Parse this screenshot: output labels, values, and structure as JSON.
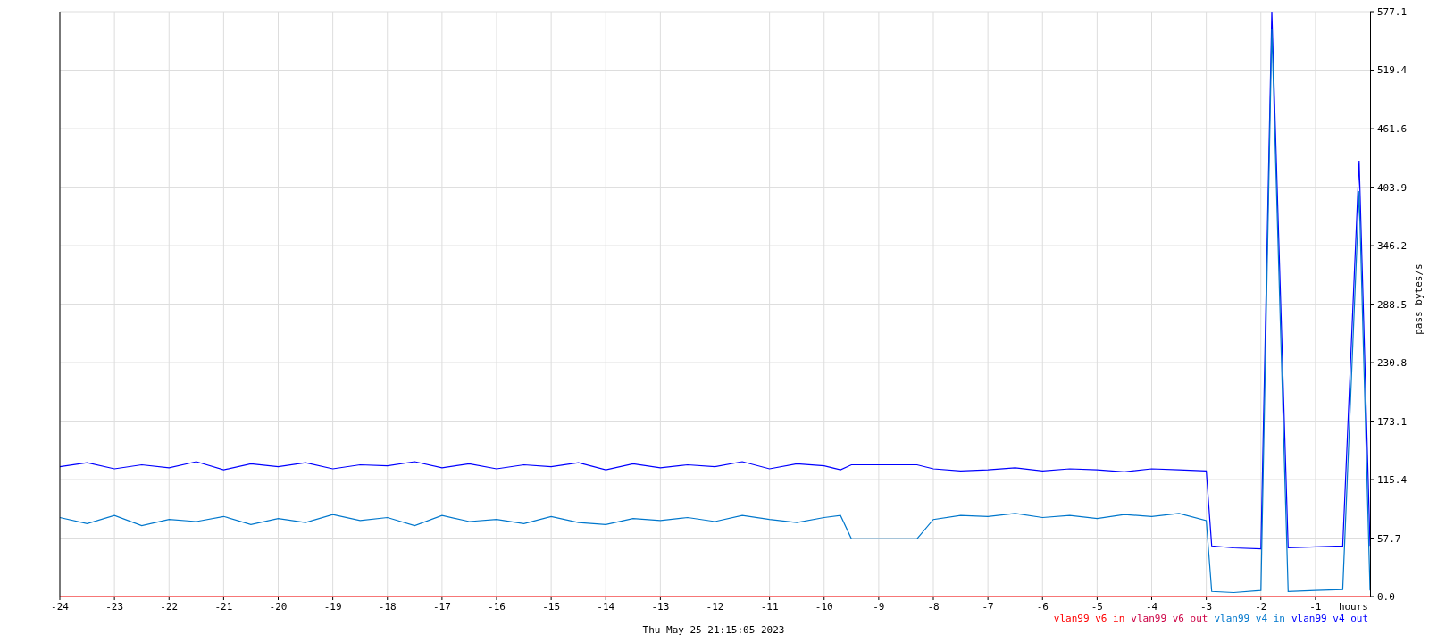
{
  "graph": {
    "timestamp": "Thu May 25 21:15:05 2023",
    "chart_data": {
      "type": "line",
      "grid": true,
      "xlabel": "hours",
      "ylabel": "pass bytes/s",
      "xlim": [
        -24,
        0
      ],
      "ylim": [
        0,
        577.1
      ],
      "xticks": [
        -24,
        -23,
        -22,
        -21,
        -20,
        -19,
        -18,
        -17,
        -16,
        -15,
        -14,
        -13,
        -12,
        -11,
        -10,
        -9,
        -8,
        -7,
        -6,
        -5,
        -4,
        -3,
        -2,
        -1
      ],
      "yticks": [
        {
          "value": 0,
          "label": "0.0"
        },
        57.7,
        115.4,
        173.1,
        230.8,
        288.5,
        346.2,
        403.9,
        461.6,
        519.4,
        577.1
      ],
      "x": [
        -24,
        -23.5,
        -23,
        -22.5,
        -22,
        -21.5,
        -21,
        -20.5,
        -20,
        -19.5,
        -19,
        -18.5,
        -18,
        -17.5,
        -17,
        -16.5,
        -16,
        -15.5,
        -15,
        -14.5,
        -14,
        -13.5,
        -13,
        -12.5,
        -12,
        -11.5,
        -11,
        -10.5,
        -10,
        -9.7,
        -9.5,
        -9,
        -8.5,
        -8.3,
        -8,
        -7.5,
        -7,
        -6.5,
        -6,
        -5.5,
        -5,
        -4.5,
        -4,
        -3.5,
        -3,
        -2.9,
        -2.5,
        -2,
        -1.8,
        -1.5,
        -1,
        -0.5,
        -0.2,
        0
      ],
      "series": [
        {
          "name": "vlan99 v6 in",
          "color": "#ff0000",
          "values": [
            0,
            0,
            0,
            0,
            0,
            0,
            0,
            0,
            0,
            0,
            0,
            0,
            0,
            0,
            0,
            0,
            0,
            0,
            0,
            0,
            0,
            0,
            0,
            0,
            0,
            0,
            0,
            0,
            0,
            0,
            0,
            0,
            0,
            0,
            0,
            0,
            0,
            0,
            0,
            0,
            0,
            0,
            0,
            0,
            0,
            0,
            0,
            0,
            0,
            0,
            0,
            0,
            0,
            0
          ]
        },
        {
          "name": "vlan99 v6 out",
          "color": "#cc0044",
          "values": [
            null,
            null,
            null,
            null,
            null,
            null,
            null,
            null,
            null,
            null,
            null,
            null,
            null,
            null,
            null,
            null,
            null,
            null,
            null,
            null,
            null,
            null,
            null,
            null,
            null,
            null,
            null,
            null,
            null,
            null,
            null,
            null,
            null,
            null,
            null,
            null,
            null,
            null,
            null,
            null,
            null,
            null,
            null,
            null,
            null,
            null,
            null,
            null,
            null,
            null,
            null,
            null,
            null,
            null
          ]
        },
        {
          "name": "vlan99 v4 in",
          "color": "#0077cc",
          "values": [
            78,
            72,
            80,
            70,
            76,
            74,
            79,
            71,
            77,
            73,
            81,
            75,
            78,
            70,
            80,
            74,
            76,
            72,
            79,
            73,
            71,
            77,
            75,
            78,
            74,
            80,
            76,
            73,
            78,
            80,
            57,
            57,
            57,
            57,
            76,
            80,
            79,
            82,
            78,
            80,
            77,
            81,
            79,
            82,
            75,
            5,
            4,
            6,
            560,
            5,
            6,
            7,
            400,
            6
          ]
        },
        {
          "name": "vlan99 v4 out",
          "color": "#0000ff",
          "values": [
            128,
            132,
            126,
            130,
            127,
            133,
            125,
            131,
            128,
            132,
            126,
            130,
            129,
            133,
            127,
            131,
            126,
            130,
            128,
            132,
            125,
            131,
            127,
            130,
            128,
            133,
            126,
            131,
            129,
            125,
            130,
            130,
            130,
            130,
            126,
            124,
            125,
            127,
            124,
            126,
            125,
            123,
            126,
            125,
            124,
            50,
            48,
            47,
            577,
            48,
            49,
            50,
            430,
            50
          ]
        }
      ]
    }
  }
}
